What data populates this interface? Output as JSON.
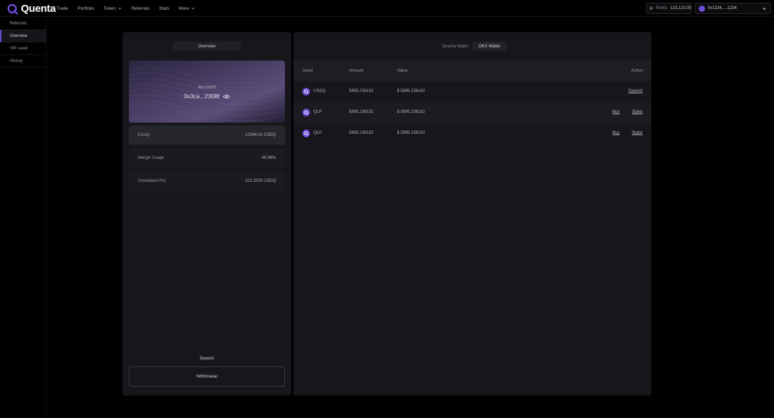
{
  "brand": {
    "name": "Quenta",
    "accent": "#6c4bd8"
  },
  "nav": {
    "links": [
      {
        "label": "Trade"
      },
      {
        "label": "Portfolio"
      },
      {
        "label": "Token",
        "dropdown": true
      },
      {
        "label": "Referrals"
      },
      {
        "label": "Stats"
      },
      {
        "label": "More",
        "dropdown": true
      }
    ],
    "points_label": "Points",
    "points_value": "123,123.00",
    "wallet_address": "0x1234.....1234"
  },
  "sidebar": {
    "items": [
      {
        "label": "Referrals"
      },
      {
        "label": "Overview",
        "active": true
      },
      {
        "label": "VIP Level"
      },
      {
        "label": "History"
      }
    ]
  },
  "account": {
    "tab_label": "Overview",
    "label": "Account",
    "address": "0x3ca...2308f",
    "metrics": [
      {
        "label": "Equity",
        "value": "12094.01 USDQ"
      },
      {
        "label": "Margin Usage",
        "value": "49.96%"
      },
      {
        "label": "Unrealized PnL",
        "value": "312.3200 USDQ"
      }
    ],
    "deposit_label": "Deposit",
    "withdrawal_label": "Withdrawal"
  },
  "wallet_table": {
    "tabs": [
      {
        "label": "Quenta Wallet"
      },
      {
        "label": "OKX Wallet",
        "active": true
      }
    ],
    "headers": {
      "asset": "Asset",
      "amount": "Amount",
      "value": "Value",
      "action": "Action"
    },
    "rows": [
      {
        "asset": "USDQ",
        "amount": "5895.236182",
        "value": "$ 5895.236182",
        "actions": [
          "Deposit"
        ]
      },
      {
        "asset": "QLP",
        "amount": "5895.236182",
        "value": "$ 5895.236182",
        "actions": [
          "Buy",
          "Stake"
        ]
      },
      {
        "asset": "QLP",
        "amount": "5895.236182",
        "value": "$ 5895.236182",
        "actions": [
          "Buy",
          "Stake"
        ]
      }
    ]
  }
}
